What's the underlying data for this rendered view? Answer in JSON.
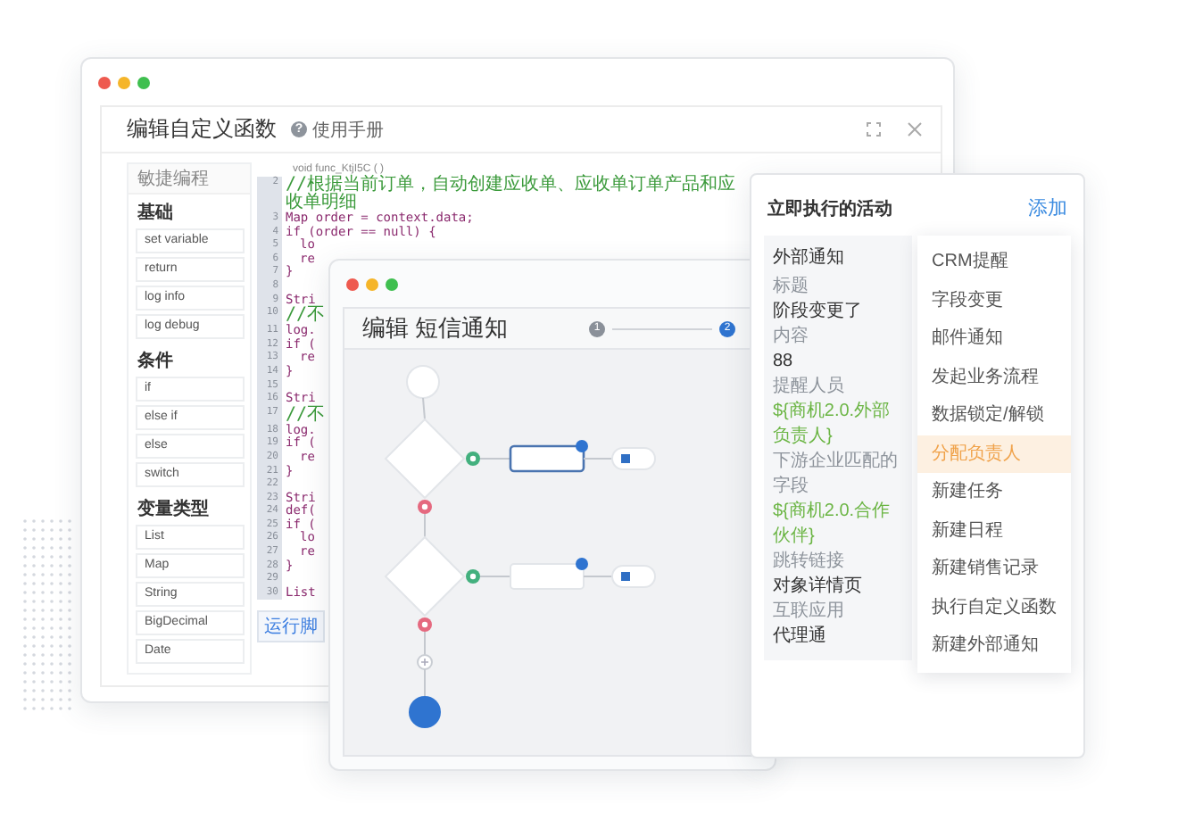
{
  "window_main": {
    "title": "编辑自定义函数",
    "help_icon": "?",
    "help": "使用手册",
    "sidebar": {
      "header": "敏捷编程",
      "groups": [
        {
          "label": "基础",
          "items": [
            "set variable",
            "return",
            "log info",
            "log debug"
          ]
        },
        {
          "label": "条件",
          "items": [
            "if",
            "else if",
            "else",
            "switch"
          ]
        },
        {
          "label": "变量类型",
          "items": [
            "List",
            "Map",
            "String",
            "BigDecimal",
            "Date"
          ]
        }
      ]
    },
    "editor": {
      "signature": "void func_KtjI5C ( )",
      "lines": [
        {
          "number": "2",
          "kind": "comment",
          "text": "//根据当前订单，自动创建应收单、应收单订单产品和应收单明细"
        },
        {
          "number": "3",
          "kind": "code",
          "text": "Map order = context.data;"
        },
        {
          "number": "4",
          "kind": "code",
          "text": "if (order == null) {"
        },
        {
          "number": "5",
          "kind": "nested",
          "text": "lo"
        },
        {
          "number": "6",
          "kind": "nested",
          "text": "re"
        },
        {
          "number": "7",
          "kind": "code",
          "text": "}"
        },
        {
          "number": "8",
          "kind": "blank"
        },
        {
          "number": "9",
          "kind": "code",
          "text": "Stri"
        },
        {
          "number": "10",
          "kind": "comment",
          "text": "//不"
        },
        {
          "number": "11",
          "kind": "code",
          "text": "log."
        },
        {
          "number": "12",
          "kind": "code",
          "text": "if ("
        },
        {
          "number": "13",
          "kind": "nested",
          "text": "re"
        },
        {
          "number": "14",
          "kind": "code",
          "text": "}"
        },
        {
          "number": "15",
          "kind": "blank"
        },
        {
          "number": "16",
          "kind": "code",
          "text": "Stri"
        },
        {
          "number": "17",
          "kind": "comment",
          "text": "//不"
        },
        {
          "number": "18",
          "kind": "code",
          "text": "log."
        },
        {
          "number": "19",
          "kind": "code",
          "text": "if ("
        },
        {
          "number": "20",
          "kind": "nested",
          "text": "re"
        },
        {
          "number": "21",
          "kind": "code",
          "text": "}"
        },
        {
          "number": "22",
          "kind": "blank"
        },
        {
          "number": "23",
          "kind": "code",
          "text": "Stri"
        },
        {
          "number": "24",
          "kind": "code",
          "text": "def("
        },
        {
          "number": "25",
          "kind": "code",
          "text": "if ("
        },
        {
          "number": "26",
          "kind": "nested",
          "text": "lo"
        },
        {
          "number": "27",
          "kind": "nested",
          "text": "re"
        },
        {
          "number": "28",
          "kind": "code",
          "text": "}"
        },
        {
          "number": "29",
          "kind": "blank"
        },
        {
          "number": "30",
          "kind": "code",
          "text": "List"
        }
      ],
      "run_button": "运行脚"
    }
  },
  "window_flow": {
    "title": "编辑 短信通知",
    "steps": [
      {
        "number": "1",
        "selected": false
      },
      {
        "number": "2",
        "selected": true
      }
    ]
  },
  "activity_panel": {
    "title": "立即执行的活动",
    "add": "添加",
    "detail": [
      {
        "kind": "heading",
        "text": "外部通知"
      },
      {
        "kind": "label",
        "text": "标题"
      },
      {
        "kind": "value",
        "text": "阶段变更了"
      },
      {
        "kind": "label",
        "text": "内容"
      },
      {
        "kind": "value",
        "text": "88"
      },
      {
        "kind": "label",
        "text": "提醒人员"
      },
      {
        "kind": "variable",
        "text": "${商机2.0.外部负责人}"
      },
      {
        "kind": "label",
        "text": "下游企业匹配的字段"
      },
      {
        "kind": "variable",
        "text": "${商机2.0.合作伙伴}"
      },
      {
        "kind": "label",
        "text": "跳转链接"
      },
      {
        "kind": "value",
        "text": "对象详情页"
      },
      {
        "kind": "label",
        "text": "互联应用"
      },
      {
        "kind": "value",
        "text": "代理通"
      }
    ],
    "menu": [
      {
        "label": "CRM提醒",
        "selected": false
      },
      {
        "label": "字段变更",
        "selected": false
      },
      {
        "label": "邮件通知",
        "selected": false
      },
      {
        "label": "发起业务流程",
        "selected": false
      },
      {
        "label": "数据锁定/解锁",
        "selected": false
      },
      {
        "label": "分配负责人",
        "selected": true
      },
      {
        "label": "新建任务",
        "selected": false
      },
      {
        "label": "新建日程",
        "selected": false
      },
      {
        "label": "新建销售记录",
        "selected": false
      },
      {
        "label": "执行自定义函数",
        "selected": false
      },
      {
        "label": "新建外部通知",
        "selected": false
      }
    ]
  }
}
